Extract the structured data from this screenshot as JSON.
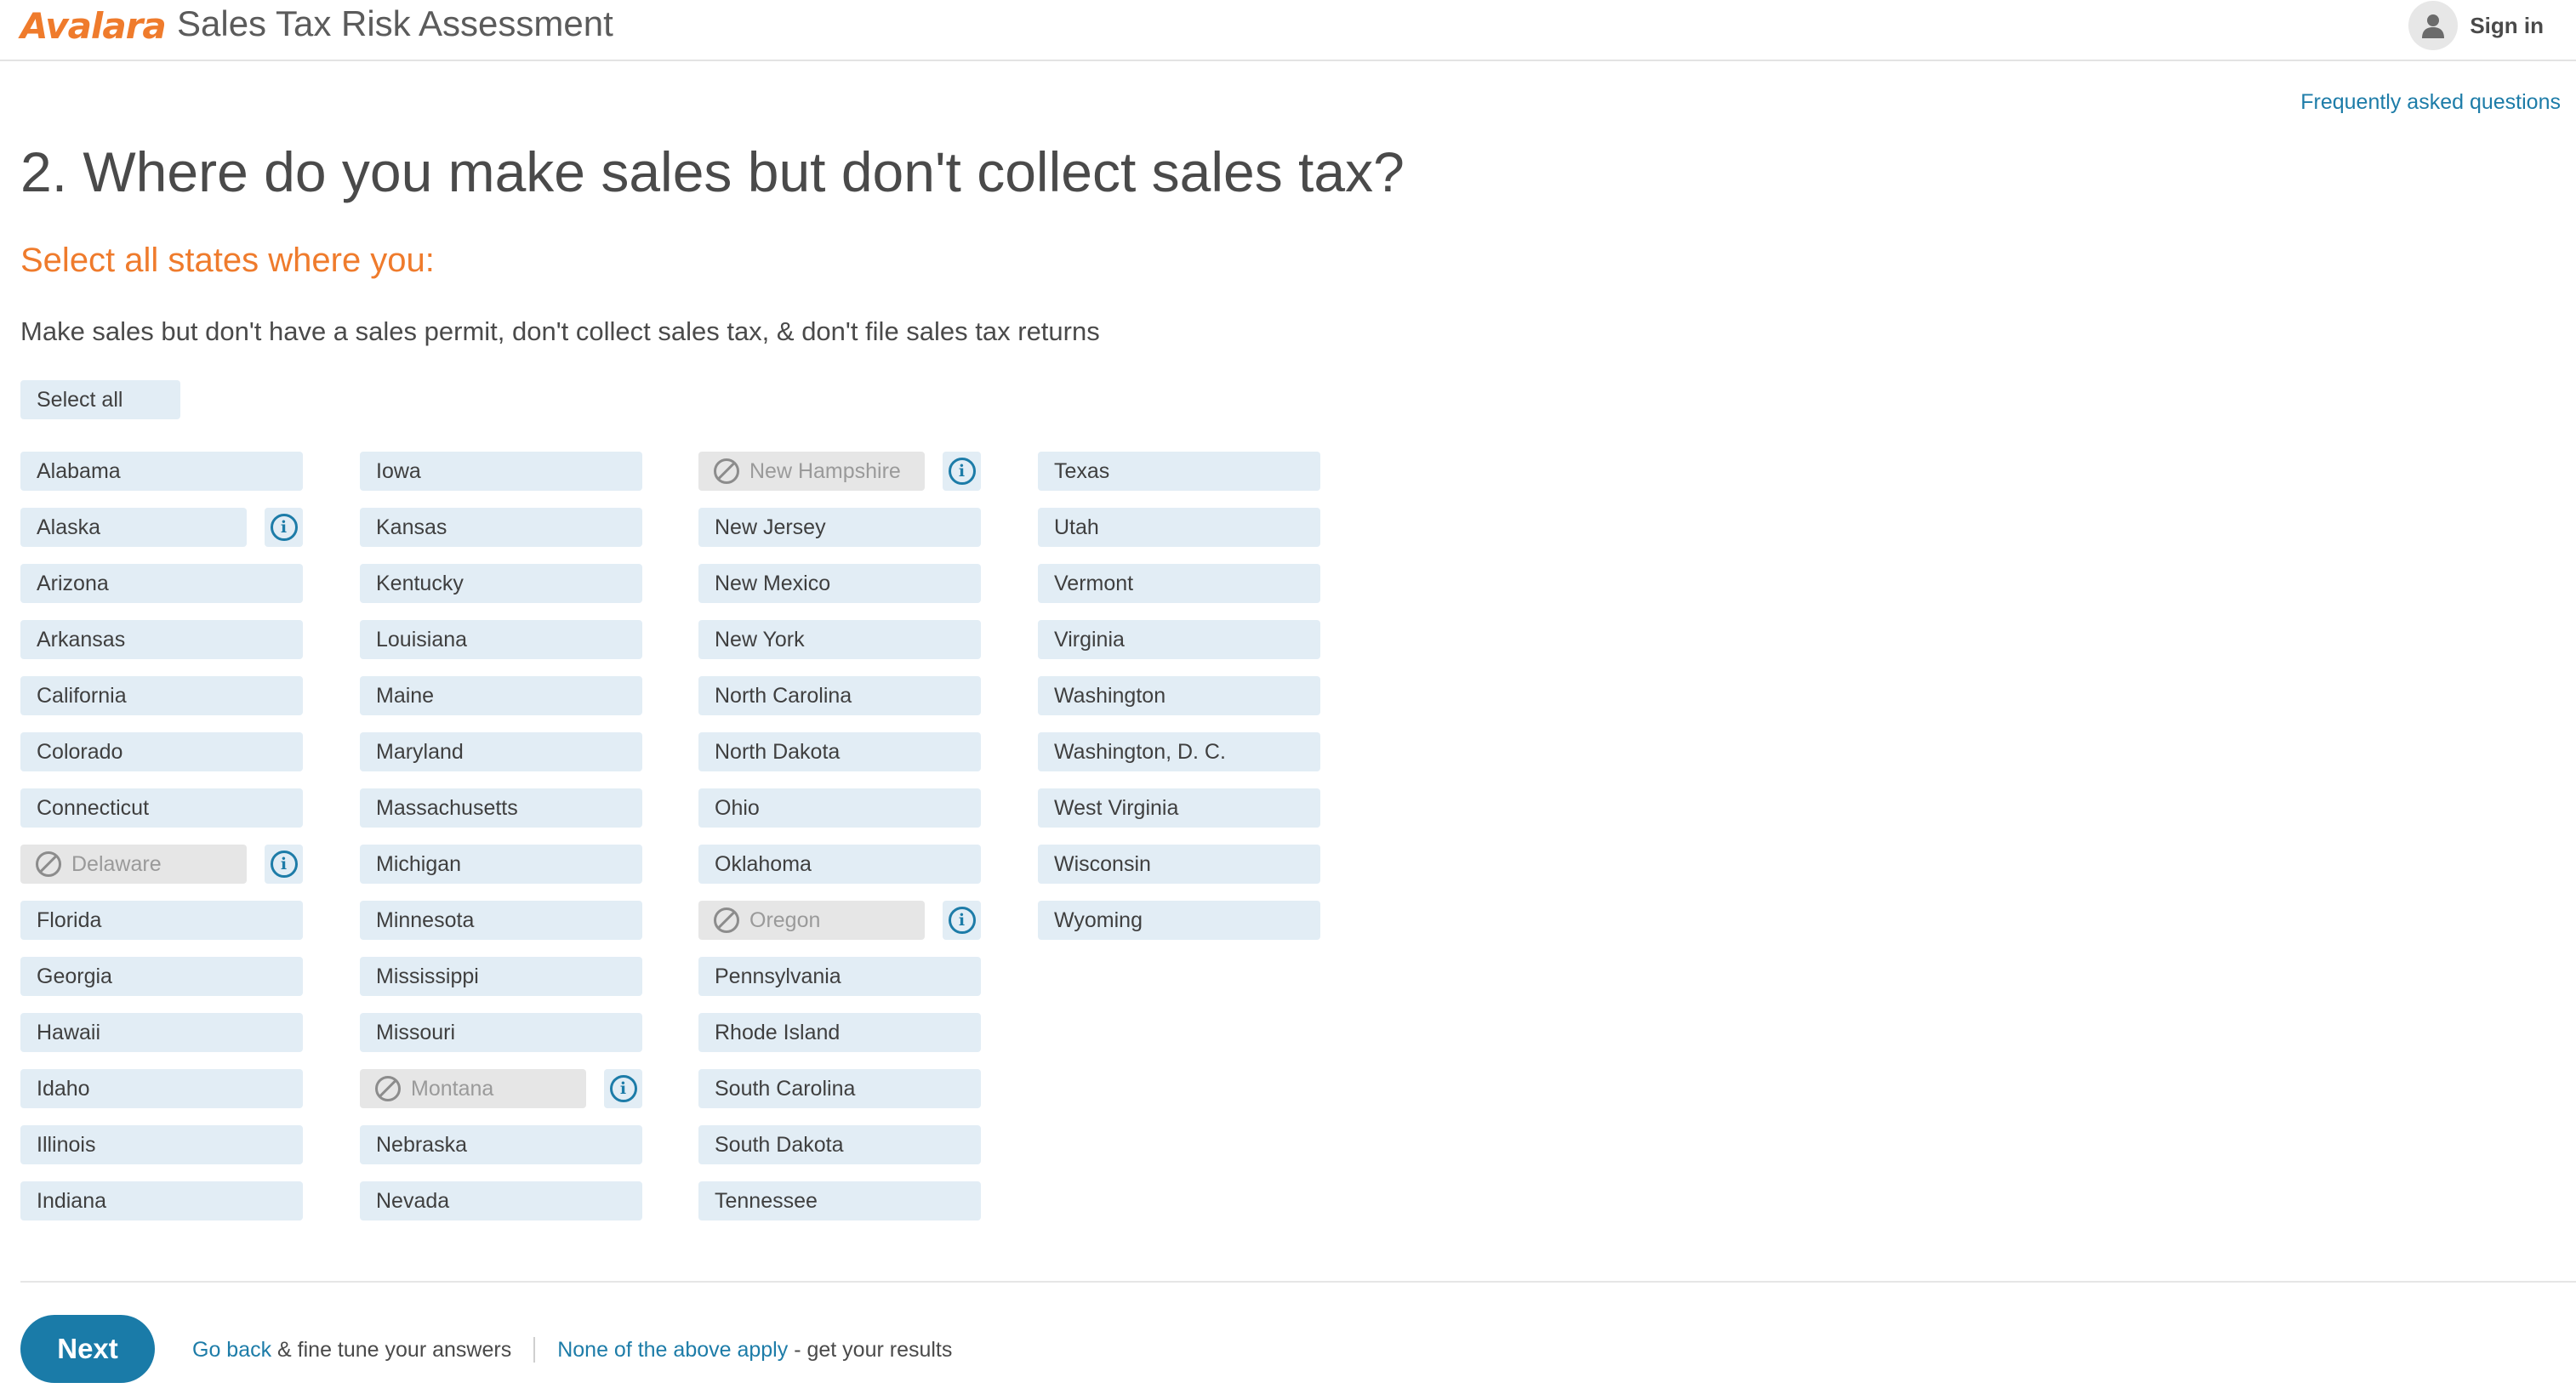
{
  "header": {
    "logo_text": "Avalara",
    "app_title": "Sales Tax Risk Assessment",
    "signin_label": "Sign in"
  },
  "faq_link": "Frequently asked questions",
  "question": "2. Where do you make sales but don't collect sales tax?",
  "subhead": "Select all states where you:",
  "instructions": "Make sales but don't have a sales permit, don't collect sales tax, & don't file sales tax returns",
  "select_all_label": "Select all",
  "columns": [
    [
      {
        "name": "Alabama"
      },
      {
        "name": "Alaska",
        "info": true
      },
      {
        "name": "Arizona"
      },
      {
        "name": "Arkansas"
      },
      {
        "name": "California"
      },
      {
        "name": "Colorado"
      },
      {
        "name": "Connecticut"
      },
      {
        "name": "Delaware",
        "disabled": true,
        "info": true
      },
      {
        "name": "Florida"
      },
      {
        "name": "Georgia"
      },
      {
        "name": "Hawaii"
      },
      {
        "name": "Idaho"
      },
      {
        "name": "Illinois"
      },
      {
        "name": "Indiana"
      }
    ],
    [
      {
        "name": "Iowa"
      },
      {
        "name": "Kansas"
      },
      {
        "name": "Kentucky"
      },
      {
        "name": "Louisiana"
      },
      {
        "name": "Maine"
      },
      {
        "name": "Maryland"
      },
      {
        "name": "Massachusetts"
      },
      {
        "name": "Michigan"
      },
      {
        "name": "Minnesota"
      },
      {
        "name": "Mississippi"
      },
      {
        "name": "Missouri"
      },
      {
        "name": "Montana",
        "disabled": true,
        "info": true
      },
      {
        "name": "Nebraska"
      },
      {
        "name": "Nevada"
      }
    ],
    [
      {
        "name": "New Hampshire",
        "disabled": true,
        "info": true
      },
      {
        "name": "New Jersey"
      },
      {
        "name": "New Mexico"
      },
      {
        "name": "New York"
      },
      {
        "name": "North Carolina"
      },
      {
        "name": "North Dakota"
      },
      {
        "name": "Ohio"
      },
      {
        "name": "Oklahoma"
      },
      {
        "name": "Oregon",
        "disabled": true,
        "info": true
      },
      {
        "name": "Pennsylvania"
      },
      {
        "name": "Rhode Island"
      },
      {
        "name": "South Carolina"
      },
      {
        "name": "South Dakota"
      },
      {
        "name": "Tennessee"
      }
    ],
    [
      {
        "name": "Texas"
      },
      {
        "name": "Utah"
      },
      {
        "name": "Vermont"
      },
      {
        "name": "Virginia"
      },
      {
        "name": "Washington"
      },
      {
        "name": "Washington, D. C."
      },
      {
        "name": "West Virginia"
      },
      {
        "name": "Wisconsin"
      },
      {
        "name": "Wyoming"
      }
    ]
  ],
  "footer": {
    "next_label": "Next",
    "go_back_link": "Go back",
    "go_back_text": " & fine tune your answers",
    "none_link": "None of the above apply",
    "none_text": " - get your results"
  },
  "colors": {
    "brand_orange": "#ef7b2c",
    "link_blue": "#1d7ca8",
    "state_bg": "#e2edf5",
    "disabled_bg": "#e6e6e6"
  },
  "icons": [
    "user-icon",
    "info-icon",
    "ban-icon"
  ]
}
